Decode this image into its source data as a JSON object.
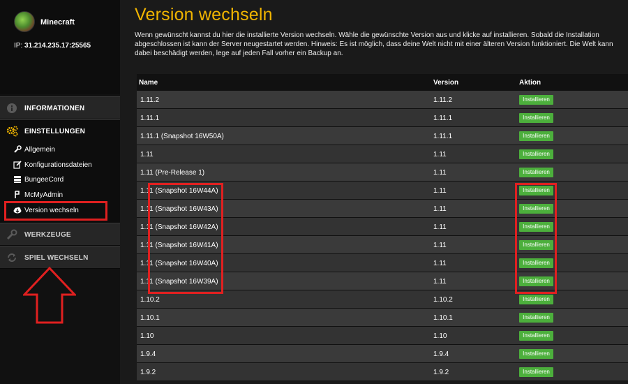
{
  "server": {
    "name": "Minecraft",
    "ip_label": "IP:",
    "ip_value": "31.214.235.17:25565"
  },
  "sidebar": {
    "sections": [
      {
        "label": "INFORMATIONEN",
        "icon": "info-icon"
      },
      {
        "label": "EINSTELLUNGEN",
        "icon": "gears-icon"
      },
      {
        "label": "WERKZEUGE",
        "icon": "wrench-icon"
      },
      {
        "label": "SPIEL WECHSELN",
        "icon": "refresh-icon"
      }
    ],
    "sub_items": [
      {
        "label": "Allgemein",
        "icon": "wrench-icon"
      },
      {
        "label": "Konfigurationsdateien",
        "icon": "edit-icon"
      },
      {
        "label": "BungeeCord",
        "icon": "server-icon"
      },
      {
        "label": "McMyAdmin",
        "icon": "mcmyadmin-icon"
      },
      {
        "label": "Version wechseln",
        "icon": "cloud-download-icon"
      }
    ]
  },
  "main": {
    "title": "Version wechseln",
    "description": "Wenn gewünscht kannst du hier die installierte Version wechseln. Wähle die gewünschte Version aus und klicke auf installieren. Sobald die Installation abgeschlossen ist kann der Server neugestartet werden. Hinweis: Es ist möglich, dass deine Welt nicht mit einer älteren Version funktioniert. Die Welt kann dabei beschädigt werden, lege auf jeden Fall vorher ein Backup an."
  },
  "table": {
    "headers": {
      "name": "Name",
      "version": "Version",
      "action": "Aktion"
    },
    "button_label": "Installieren",
    "rows": [
      {
        "name": "1.11.2",
        "version": "1.11.2"
      },
      {
        "name": "1.11.1",
        "version": "1.11.1"
      },
      {
        "name": "1.11.1 (Snapshot 16W50A)",
        "version": "1.11.1"
      },
      {
        "name": "1.11",
        "version": "1.11"
      },
      {
        "name": "1.11 (Pre-Release 1)",
        "version": "1.11"
      },
      {
        "name": "1.11 (Snapshot 16W44A)",
        "version": "1.11"
      },
      {
        "name": "1.11 (Snapshot 16W43A)",
        "version": "1.11"
      },
      {
        "name": "1.11 (Snapshot 16W42A)",
        "version": "1.11"
      },
      {
        "name": "1.11 (Snapshot 16W41A)",
        "version": "1.11"
      },
      {
        "name": "1.11 (Snapshot 16W40A)",
        "version": "1.11"
      },
      {
        "name": "1.11 (Snapshot 16W39A)",
        "version": "1.11"
      },
      {
        "name": "1.10.2",
        "version": "1.10.2"
      },
      {
        "name": "1.10.1",
        "version": "1.10.1"
      },
      {
        "name": "1.10",
        "version": "1.10"
      },
      {
        "name": "1.9.4",
        "version": "1.9.4"
      },
      {
        "name": "1.9.2",
        "version": "1.9.2"
      }
    ]
  },
  "colors": {
    "accent": "#f0b400",
    "button": "#4caf3c",
    "annotation": "#e02020"
  }
}
